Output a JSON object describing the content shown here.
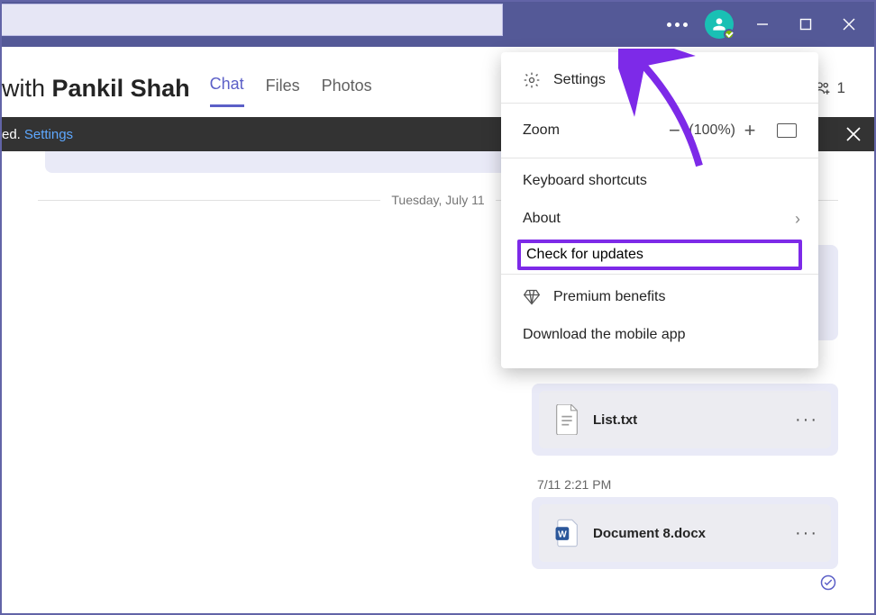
{
  "header": {
    "title_prefix": "with",
    "title_name": "Pankil Shah",
    "tabs": [
      "Chat",
      "Files",
      "Photos"
    ],
    "active_tab": 0,
    "participant_count": "1"
  },
  "banner": {
    "text_suffix": "ed.",
    "link": "Settings"
  },
  "chat": {
    "date_divider": "Tuesday, July 11",
    "messages": [
      {
        "time": "",
        "filename": "",
        "filetype": ""
      },
      {
        "time": "",
        "filename": "List.txt",
        "filetype": "txt"
      },
      {
        "time": "7/11 2:21 PM",
        "filename": "Document 8.docx",
        "filetype": "docx"
      }
    ]
  },
  "menu": {
    "settings": "Settings",
    "zoom_label": "Zoom",
    "zoom_value": "(100%)",
    "keyboard_shortcuts": "Keyboard shortcuts",
    "about": "About",
    "check_updates": "Check for updates",
    "premium": "Premium benefits",
    "download": "Download the mobile app"
  }
}
